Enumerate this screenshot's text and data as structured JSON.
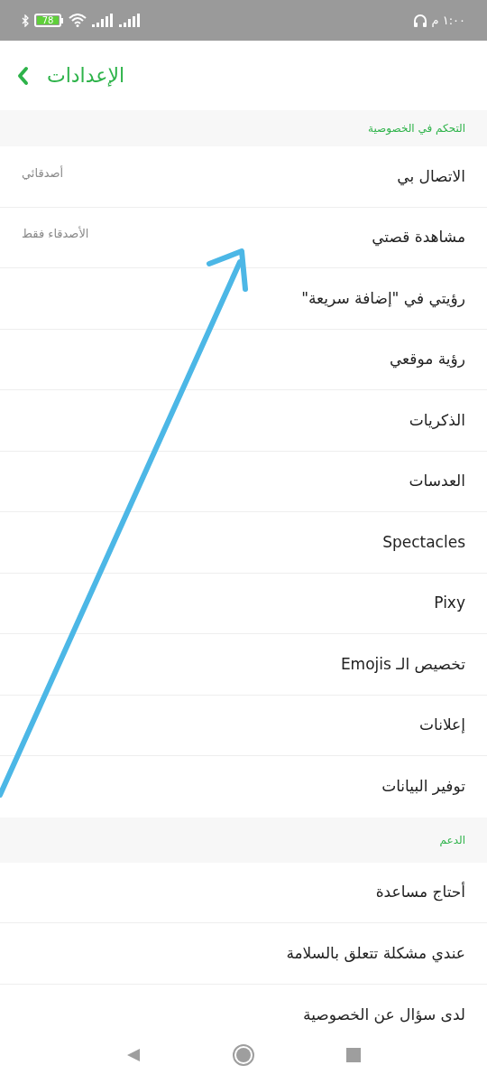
{
  "status_bar": {
    "time": "١:٠٠ م",
    "battery": "78"
  },
  "header": {
    "title": "الإعدادات"
  },
  "sections": [
    {
      "title": "التحكم في الخصوصية",
      "items": [
        {
          "label": "الاتصال بي",
          "value": "أصدقائي"
        },
        {
          "label": "مشاهدة قصتي",
          "value": "الأصدقاء فقط"
        },
        {
          "label": "رؤيتي في \"إضافة سريعة\""
        },
        {
          "label": "رؤية موقعي"
        },
        {
          "label": "الذكريات"
        },
        {
          "label": "العدسات"
        },
        {
          "label": "Spectacles"
        },
        {
          "label": "Pixy"
        },
        {
          "label": "تخصيص الـ Emojis"
        },
        {
          "label": "إعلانات"
        },
        {
          "label": "توفير البيانات"
        }
      ]
    },
    {
      "title": "الدعم",
      "items": [
        {
          "label": "أحتاج مساعدة"
        },
        {
          "label": "عندي مشكلة تتعلق بالسلامة"
        },
        {
          "label": "لدى سؤال عن الخصوصية"
        }
      ]
    }
  ]
}
